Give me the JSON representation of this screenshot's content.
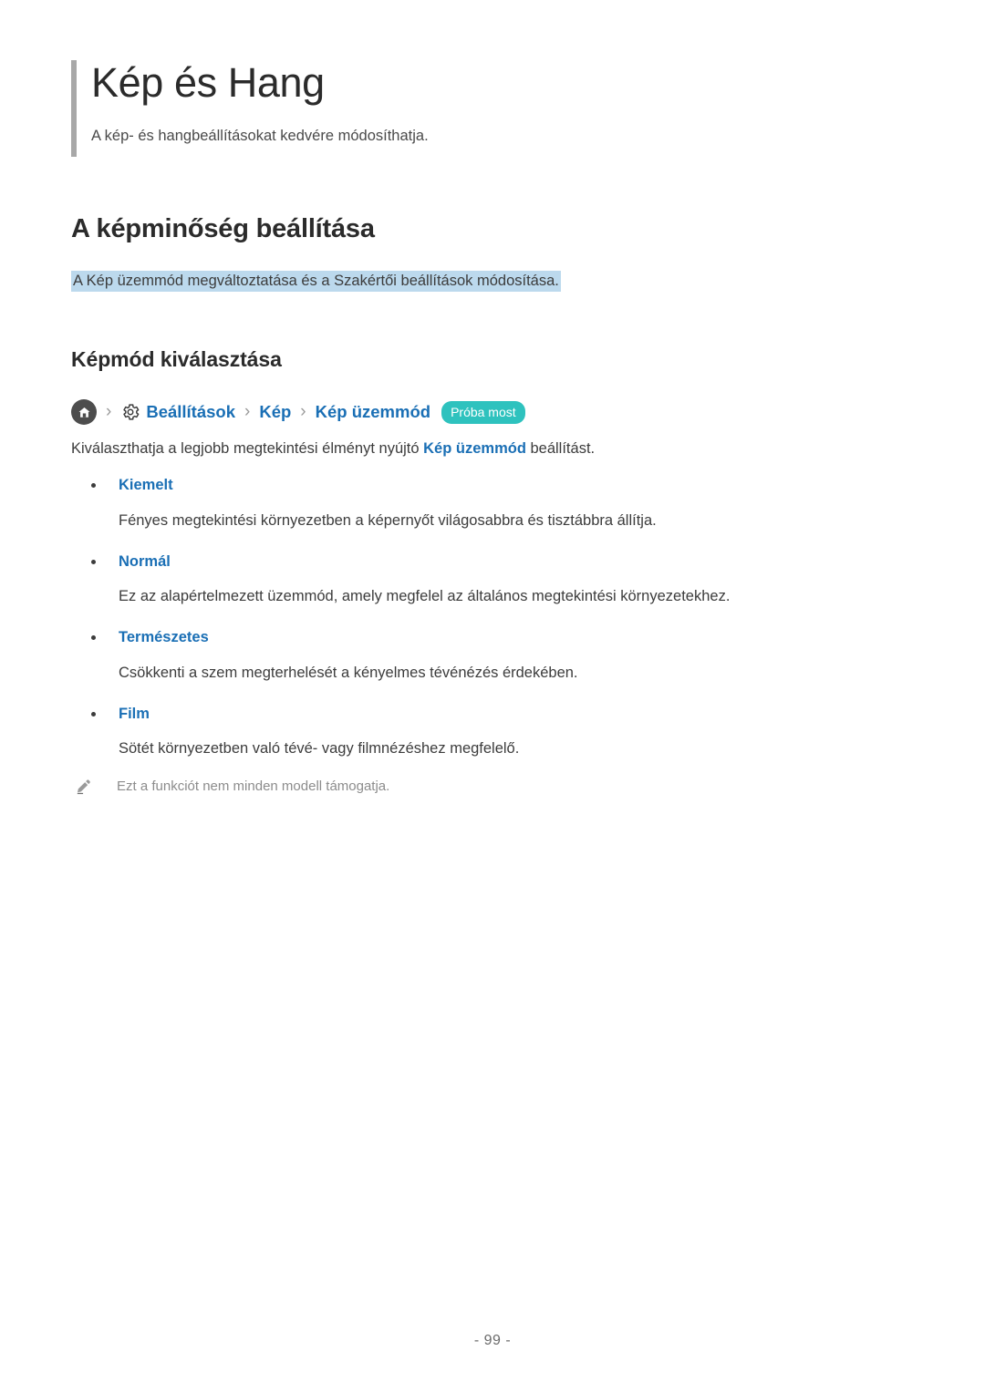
{
  "document": {
    "title": "Kép és Hang",
    "subtitle": "A kép- és hangbeállításokat kedvére módosíthatja.",
    "page_number": "- 99 -"
  },
  "section": {
    "heading": "A képminőség beállítása",
    "summary": "A Kép üzemmód megváltoztatása és a Szakértői beállítások módosítása."
  },
  "subsection": {
    "heading": "Képmód kiválasztása"
  },
  "breadcrumb": {
    "home_icon": "home-icon",
    "gear_icon": "gear-icon",
    "separator": "›",
    "items": [
      {
        "label": "Beállítások"
      },
      {
        "label": "Kép"
      },
      {
        "label": "Kép üzemmód"
      }
    ],
    "badge": "Próba most"
  },
  "lead_paragraph": {
    "before": "Kiválaszthatja a legjobb megtekintési élményt nyújtó ",
    "link": "Kép üzemmód",
    "after": " beállítást."
  },
  "modes": [
    {
      "term": "Kiemelt",
      "description": "Fényes megtekintési környezetben a képernyőt világosabbra és tisztábbra állítja."
    },
    {
      "term": "Normál",
      "description": "Ez az alapértelmezett üzemmód, amely megfelel az általános megtekintési környezetekhez."
    },
    {
      "term": "Természetes",
      "description": "Csökkenti a szem megterhelését a kényelmes tévénézés érdekében."
    },
    {
      "term": "Film",
      "description": "Sötét környezetben való tévé- vagy filmnézéshez megfelelő."
    }
  ],
  "note": {
    "icon": "pencil-icon",
    "text": "Ezt a funkciót nem minden modell támogatja."
  },
  "colors": {
    "link": "#1a6fb5",
    "highlight": "#bcd9ed",
    "badge": "#2ec2be",
    "accent_bar": "#a8a8a8",
    "body_text": "#3c3c3c",
    "note_text": "#8c8c8c"
  }
}
